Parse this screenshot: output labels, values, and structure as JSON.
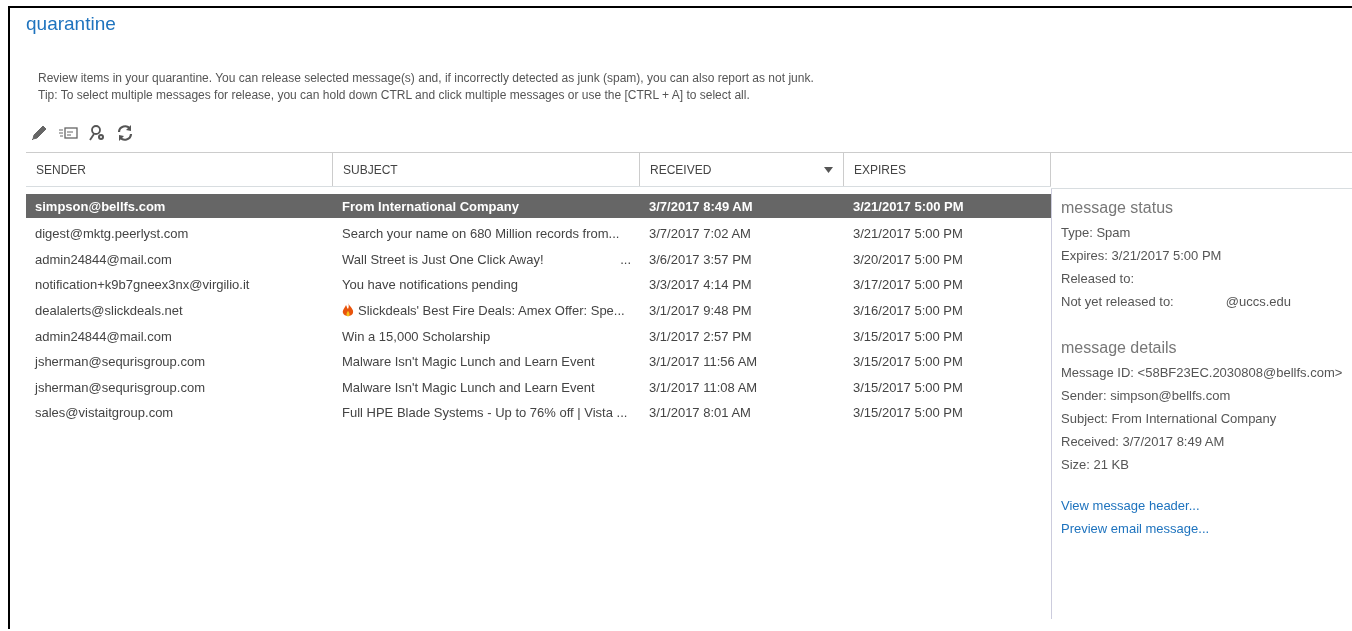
{
  "title": "quarantine",
  "description": [
    "Review items in your quarantine. You can release selected message(s) and, if incorrectly detected as junk (spam), you can also report as not junk.",
    "Tip: To select multiple messages for release, you can hold down CTRL and click multiple messages or use the [CTRL + A] to select all."
  ],
  "toolbar": [
    {
      "kind": "edit"
    },
    {
      "kind": "release"
    },
    {
      "kind": "report"
    },
    {
      "kind": "refresh"
    }
  ],
  "table": {
    "columns": [
      {
        "label": "SENDER",
        "sorted": false
      },
      {
        "label": "SUBJECT",
        "sorted": false
      },
      {
        "label": "RECEIVED",
        "sorted": true
      },
      {
        "label": "EXPIRES",
        "sorted": false
      }
    ],
    "rows": [
      {
        "kind": "plain",
        "selected": true,
        "sender": "simpson@bellfs.com",
        "subject": "From International Company",
        "received": "3/7/2017 8:49 AM",
        "expires": "3/21/2017 5:00 PM"
      },
      {
        "kind": "plain",
        "selected": false,
        "sender": "digest@mktg.peerlyst.com",
        "subject": "Search your name on 680 Million records from...",
        "received": "3/7/2017 7:02 AM",
        "expires": "3/21/2017 5:00 PM"
      },
      {
        "kind": "plain",
        "selected": false,
        "sender": "admin24844@mail.com",
        "subject": "Wall Street is Just One Click Away!",
        "subject_tail": "...",
        "received": "3/6/2017 3:57 PM",
        "expires": "3/20/2017 5:00 PM"
      },
      {
        "kind": "plain",
        "selected": false,
        "sender": "notification+k9b7gneex3nx@virgilio.it",
        "subject": "You have notifications pending",
        "received": "3/3/2017 4:14 PM",
        "expires": "3/17/2017 5:00 PM"
      },
      {
        "kind": "flame",
        "selected": false,
        "sender": "dealalerts@slickdeals.net",
        "subject": "Slickdeals' Best Fire Deals: Amex Offer: Spe...",
        "received": "3/1/2017 9:48 PM",
        "expires": "3/16/2017 5:00 PM"
      },
      {
        "kind": "plain",
        "selected": false,
        "sender": "admin24844@mail.com",
        "subject": "Win a 15,000 Scholarship",
        "received": "3/1/2017 2:57 PM",
        "expires": "3/15/2017 5:00 PM"
      },
      {
        "kind": "plain",
        "selected": false,
        "sender": "jsherman@sequrisgroup.com",
        "subject": "Malware Isn't Magic Lunch and Learn Event",
        "received": "3/1/2017 11:56 AM",
        "expires": "3/15/2017 5:00 PM"
      },
      {
        "kind": "plain",
        "selected": false,
        "sender": "jsherman@sequrisgroup.com",
        "subject": "Malware Isn't Magic Lunch and Learn Event",
        "received": "3/1/2017 11:08 AM",
        "expires": "3/15/2017 5:00 PM"
      },
      {
        "kind": "plain",
        "selected": false,
        "sender": "sales@vistaitgroup.com",
        "subject": "Full HPE Blade Systems - Up to 76% off | Vista ...",
        "received": "3/1/2017 8:01 AM",
        "expires": "3/15/2017 5:00 PM"
      }
    ]
  },
  "details": {
    "sections": [
      {
        "heading": "message status",
        "lines": [
          {
            "text": "Type: Spam"
          },
          {
            "text": "Expires: 3/21/2017 5:00 PM"
          },
          {
            "text": "Released to:"
          },
          {
            "text": "Not yet released to:",
            "value": "@uccs.edu"
          }
        ]
      },
      {
        "heading": "message details",
        "lines": [
          {
            "text": "Message ID: <58BF23EC.2030808@bellfs.com>"
          },
          {
            "text": "Sender: simpson@bellfs.com"
          },
          {
            "text": "Subject: From International Company"
          },
          {
            "text": "Received: 3/7/2017 8:49 AM"
          },
          {
            "text": "Size: 21 KB"
          }
        ]
      }
    ],
    "links": [
      "View message header...",
      "Preview email message..."
    ]
  }
}
